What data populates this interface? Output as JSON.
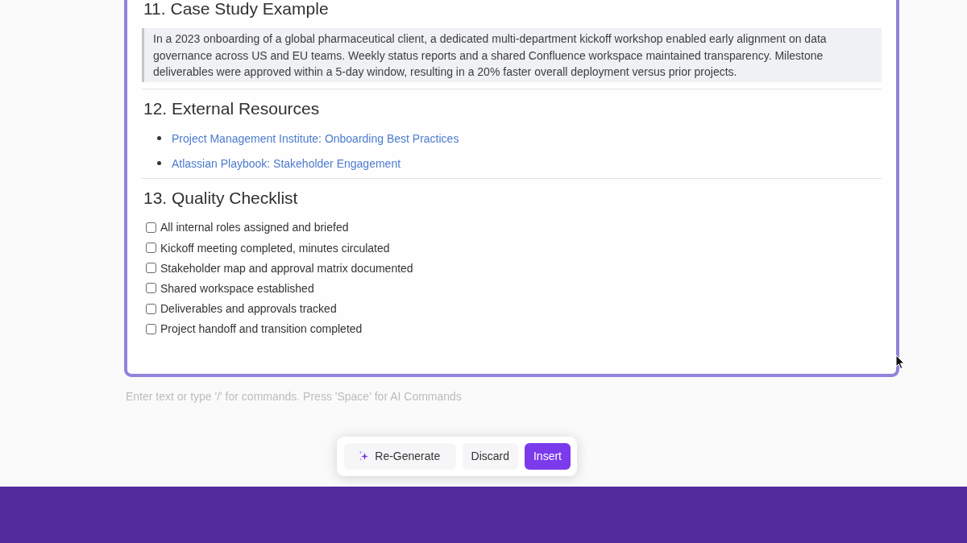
{
  "editor": {
    "sections": [
      {
        "kind": "quote",
        "heading": "11. Case Study Example",
        "text": "In a 2023 onboarding of a global pharmaceutical client, a dedicated multi-department kickoff workshop enabled early alignment on data governance across US and EU teams. Weekly status reports and a shared Confluence workspace maintained transparency. Milestone deliverables were approved within a 5-day window, resulting in a 20% faster overall deployment versus prior projects."
      },
      {
        "kind": "links",
        "heading": "12. External Resources",
        "items": [
          {
            "text": "Project Management Institute: Onboarding Best Practices"
          },
          {
            "text": "Atlassian Playbook: Stakeholder Engagement"
          }
        ]
      },
      {
        "kind": "checklist",
        "heading": "13. Quality Checklist",
        "items": [
          {
            "label": "All internal roles assigned and briefed",
            "checked": false
          },
          {
            "label": "Kickoff meeting completed, minutes circulated",
            "checked": false
          },
          {
            "label": "Stakeholder map and approval matrix documented",
            "checked": false
          },
          {
            "label": "Shared workspace established",
            "checked": false
          },
          {
            "label": "Deliverables and approvals tracked",
            "checked": false
          },
          {
            "label": "Project handoff and transition completed",
            "checked": false
          }
        ]
      }
    ]
  },
  "prompt_input": {
    "placeholder": "Enter text or type '/' for commands. Press 'Space' for AI Commands"
  },
  "action_bar": {
    "buttons": [
      {
        "kind": "ai",
        "label": "Re-Generate"
      },
      {
        "kind": "secondary",
        "label": "Discard"
      },
      {
        "kind": "primary",
        "label": "Insert"
      }
    ]
  }
}
